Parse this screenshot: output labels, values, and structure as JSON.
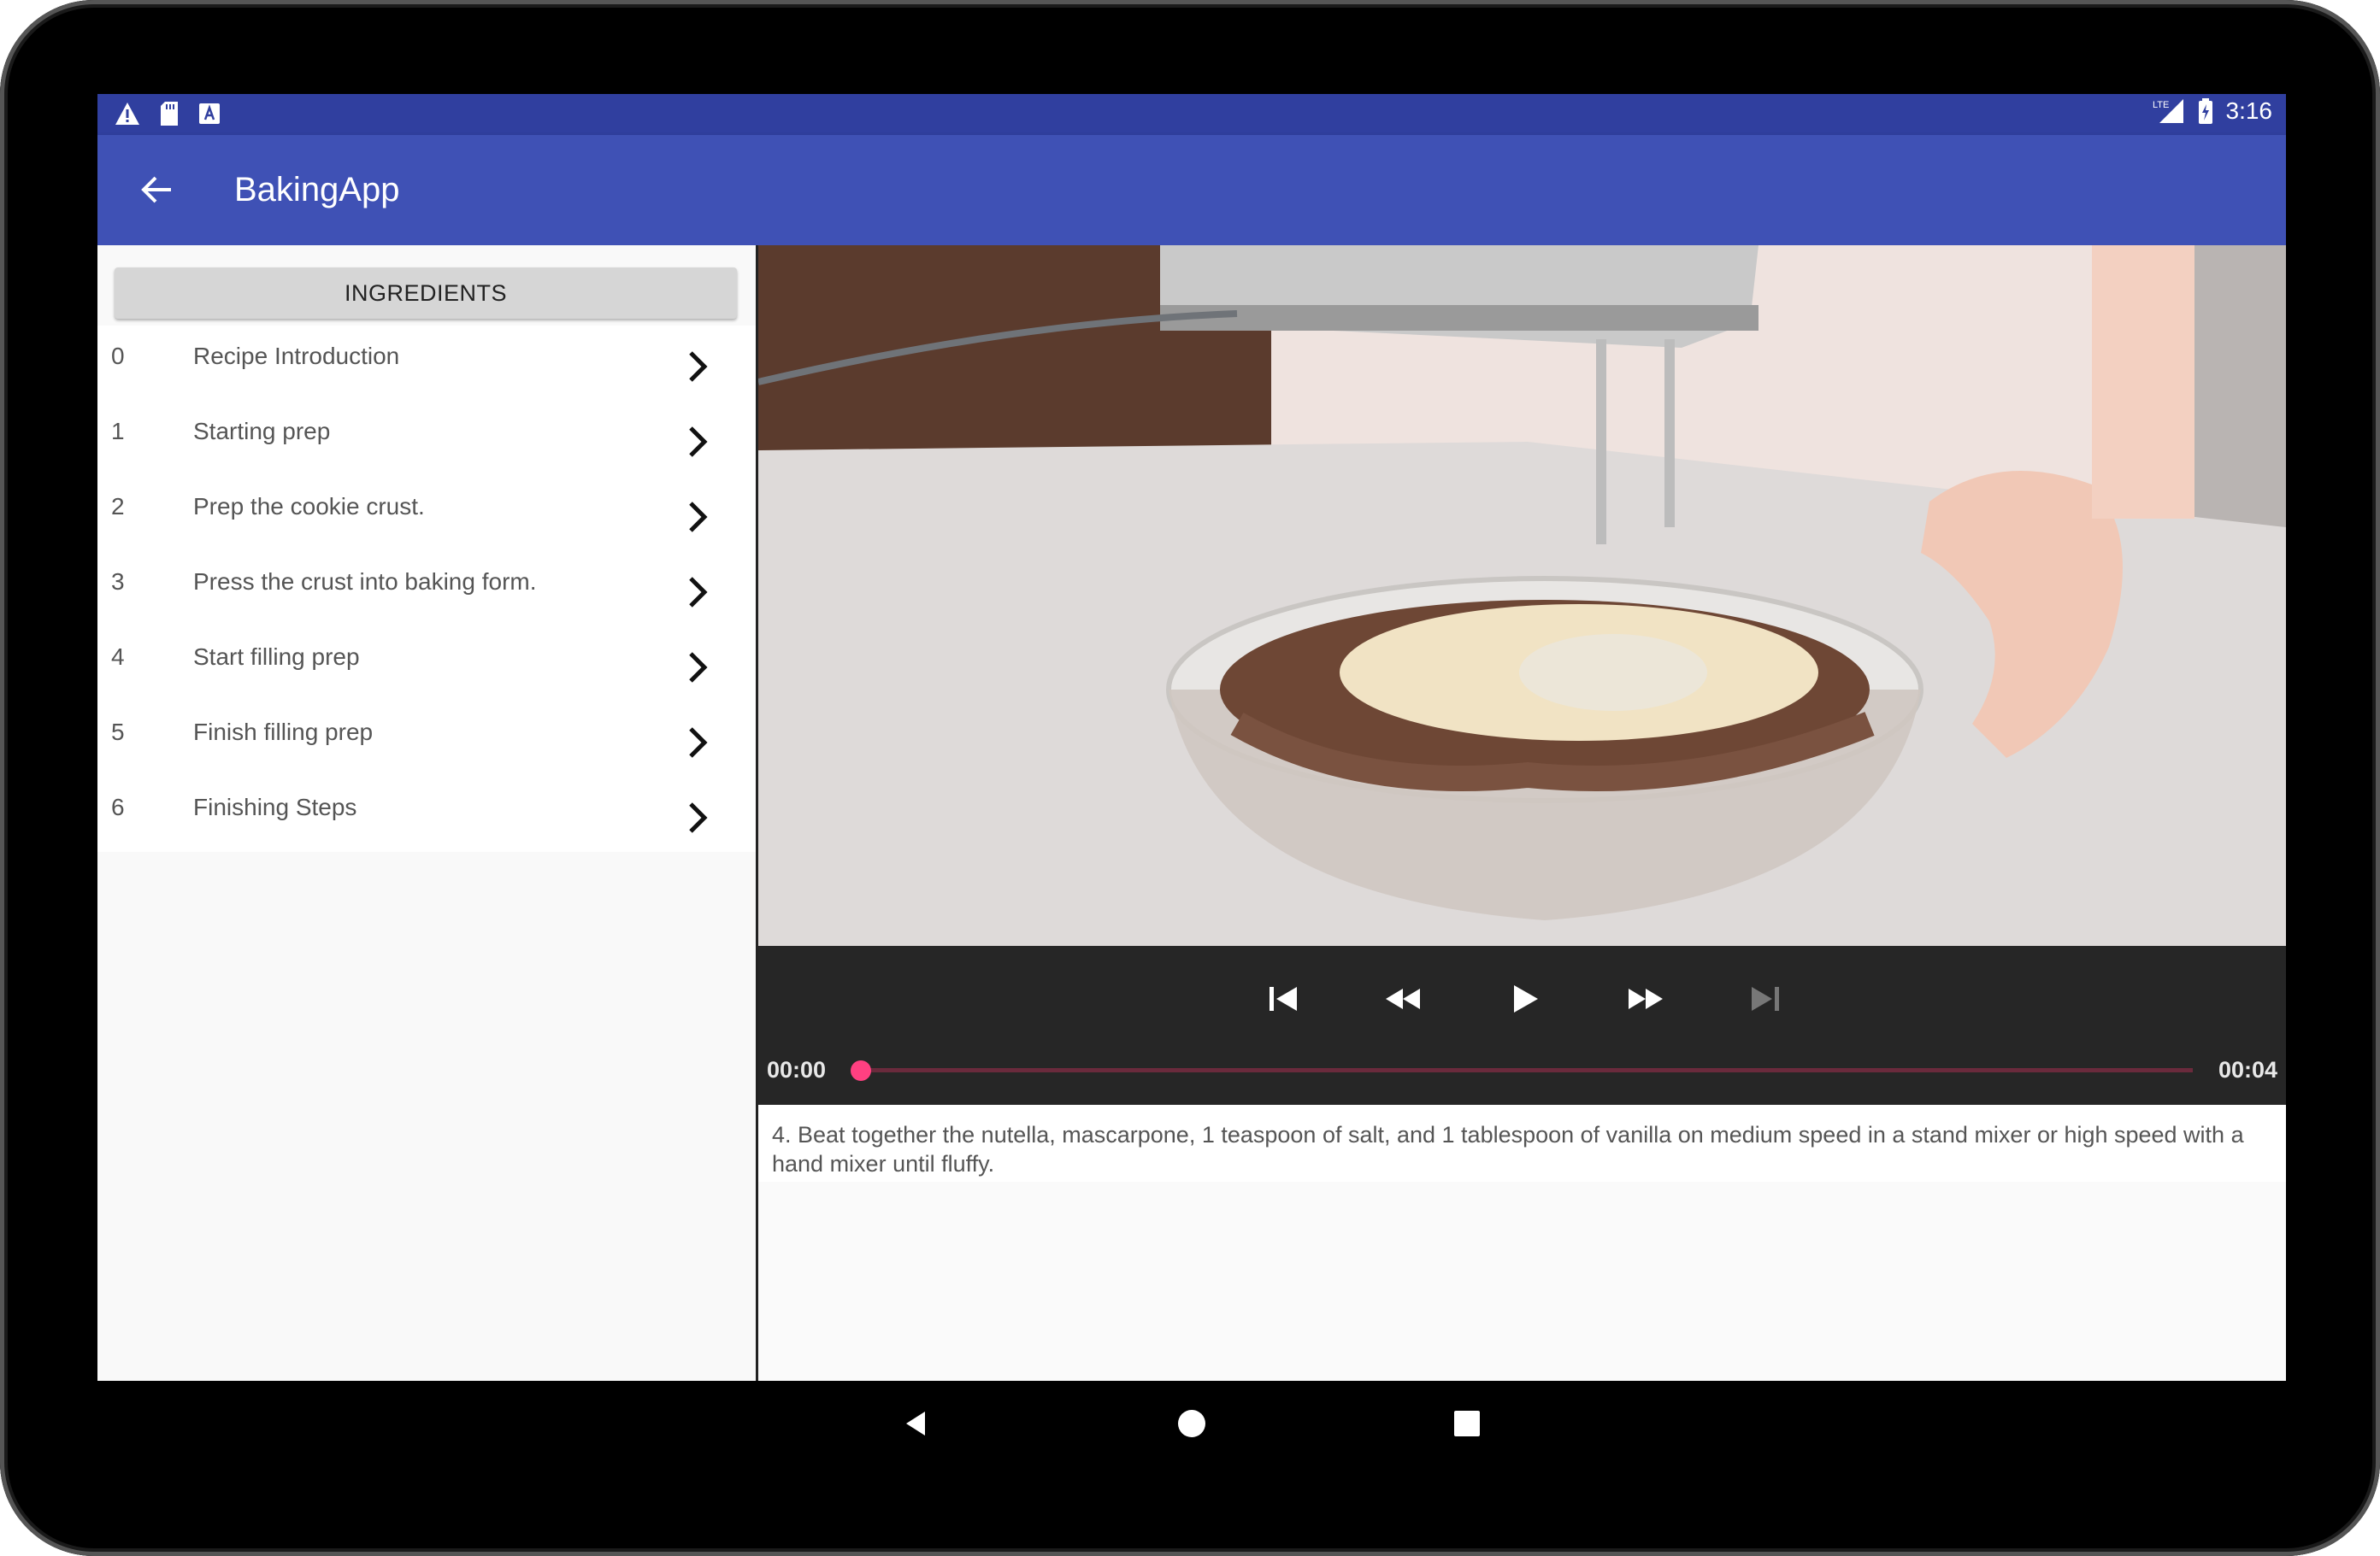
{
  "status_bar": {
    "time": "3:16",
    "left_icons": [
      "warning-icon",
      "sd-card-icon",
      "font-a-icon"
    ],
    "right_icons": [
      "lte-signal-icon",
      "battery-charging-icon"
    ]
  },
  "app_bar": {
    "title": "BakingApp",
    "back_icon": "arrow-back-icon"
  },
  "colors": {
    "status_bar": "#303f9f",
    "app_bar": "#3f51b5",
    "accent": "#ff4081",
    "player_bg": "#262626"
  },
  "sidebar": {
    "ingredients_button": "INGREDIENTS",
    "steps": [
      {
        "number": "0",
        "label": "Recipe Introduction"
      },
      {
        "number": "1",
        "label": "Starting prep"
      },
      {
        "number": "2",
        "label": "Prep the cookie crust."
      },
      {
        "number": "3",
        "label": "Press the crust into baking form."
      },
      {
        "number": "4",
        "label": "Start filling prep"
      },
      {
        "number": "5",
        "label": "Finish filling prep"
      },
      {
        "number": "6",
        "label": "Finishing Steps"
      }
    ]
  },
  "player": {
    "current_time": "00:00",
    "duration": "00:04",
    "progress": 0,
    "controls": [
      "skip-previous-icon",
      "rewind-icon",
      "play-icon",
      "fast-forward-icon",
      "skip-next-icon"
    ]
  },
  "step_description": "4. Beat together the nutella, mascarpone, 1 teaspoon of salt, and 1 tablespoon of vanilla on medium speed in a stand mixer or high speed with a hand mixer until fluffy.",
  "nav_bar": {
    "buttons": [
      "back-triangle-icon",
      "home-circle-icon",
      "recents-square-icon"
    ]
  }
}
